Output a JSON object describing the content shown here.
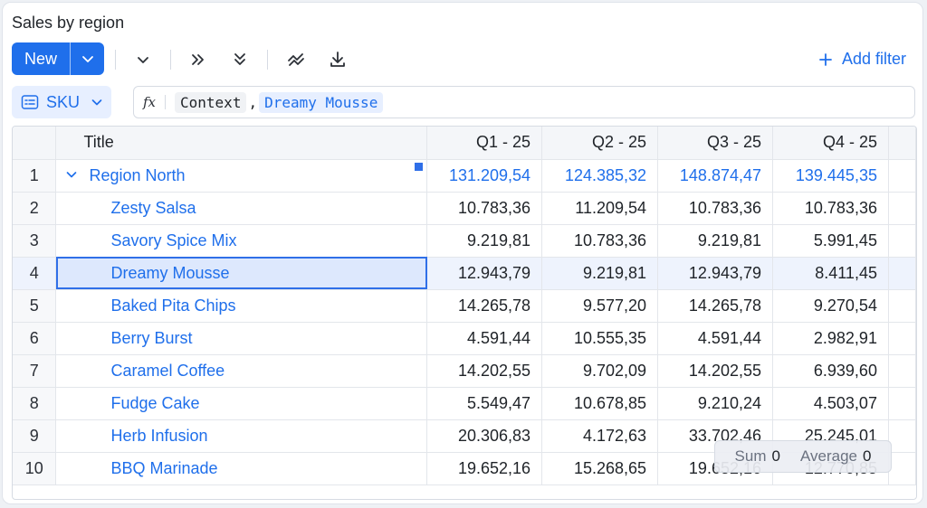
{
  "title": "Sales by region",
  "toolbar": {
    "new_label": "New",
    "add_filter_label": "Add filter",
    "icons": [
      "chevron-down-icon",
      "chevrons-right-icon",
      "chevrons-down-icon",
      "trend-icon",
      "download-icon"
    ]
  },
  "formula": {
    "column_chip_label": "SKU",
    "fx_label": "fx",
    "tokens": [
      "Context",
      "Dreamy Mousse"
    ],
    "separator": ","
  },
  "table": {
    "headers": [
      "Title",
      "Q1 - 25",
      "Q2 - 25",
      "Q3 - 25",
      "Q4 - 25"
    ],
    "rows": [
      {
        "n": "1",
        "title": "Region North",
        "q1": "131.209,54",
        "q2": "124.385,32",
        "q3": "148.874,47",
        "q4": "139.445,35"
      },
      {
        "n": "2",
        "title": "Zesty Salsa",
        "q1": "10.783,36",
        "q2": "11.209,54",
        "q3": "10.783,36",
        "q4": "10.783,36"
      },
      {
        "n": "3",
        "title": "Savory Spice Mix",
        "q1": "9.219,81",
        "q2": "10.783,36",
        "q3": "9.219,81",
        "q4": "5.991,45"
      },
      {
        "n": "4",
        "title": "Dreamy Mousse",
        "q1": "12.943,79",
        "q2": "9.219,81",
        "q3": "12.943,79",
        "q4": "8.411,45"
      },
      {
        "n": "5",
        "title": "Baked Pita Chips",
        "q1": "14.265,78",
        "q2": "9.577,20",
        "q3": "14.265,78",
        "q4": "9.270,54"
      },
      {
        "n": "6",
        "title": "Berry Burst",
        "q1": "4.591,44",
        "q2": "10.555,35",
        "q3": "4.591,44",
        "q4": "2.982,91"
      },
      {
        "n": "7",
        "title": "Caramel Coffee",
        "q1": "14.202,55",
        "q2": "9.702,09",
        "q3": "14.202,55",
        "q4": "6.939,60"
      },
      {
        "n": "8",
        "title": "Fudge Cake",
        "q1": "5.549,47",
        "q2": "10.678,85",
        "q3": "9.210,24",
        "q4": "4.503,07"
      },
      {
        "n": "9",
        "title": "Herb Infusion",
        "q1": "20.306,83",
        "q2": "4.172,63",
        "q3": "33.702,46",
        "q4": "25.245,01"
      },
      {
        "n": "10",
        "title": "BBQ Marinade",
        "q1": "19.652,16",
        "q2": "15.268,65",
        "q3": "19.652,16",
        "q4": "12.770,85"
      }
    ]
  },
  "status": {
    "sum_label": "Sum",
    "sum_value": "0",
    "avg_label": "Average",
    "avg_value": "0"
  },
  "colors": {
    "accent": "#1f6feb",
    "selection": "#2f6fe8"
  }
}
